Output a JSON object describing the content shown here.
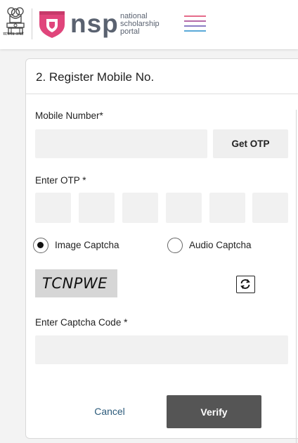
{
  "header": {
    "emblem_caption": "सत्यमेव जयते",
    "brand": "nsp",
    "tagline": [
      "national",
      "scholarship",
      "portal"
    ],
    "menu_icon": "hamburger-menu-icon",
    "colors": {
      "brand_pink": "#e0457b",
      "brand_text": "#5a6270"
    }
  },
  "form": {
    "title": "2. Register Mobile No.",
    "mobile_label": "Mobile Number*",
    "mobile_value": "",
    "get_otp_label": "Get OTP",
    "otp_label": "Enter OTP *",
    "otp_digits": [
      "",
      "",
      "",
      "",
      "",
      ""
    ],
    "captcha_options": [
      {
        "label": "Image Captcha",
        "selected": true
      },
      {
        "label": "Audio Captcha",
        "selected": false
      }
    ],
    "captcha_text": "TCNPWE",
    "refresh_icon": "refresh-icon",
    "captcha_code_label": "Enter Captcha Code *",
    "captcha_code_value": "",
    "cancel_label": "Cancel",
    "verify_label": "Verify"
  }
}
